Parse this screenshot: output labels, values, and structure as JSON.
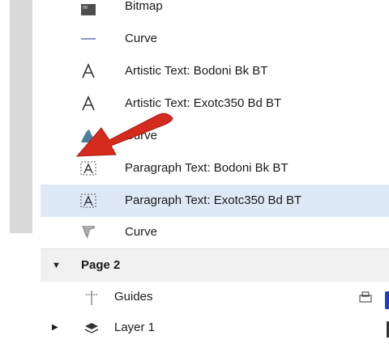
{
  "objects": [
    {
      "label": "Bitmap",
      "icon": "bitmap-icon"
    },
    {
      "label": "Curve",
      "icon": "curve-line-icon"
    },
    {
      "label": "Artistic Text: Bodoni Bk BT",
      "icon": "artistic-text-icon"
    },
    {
      "label": "Artistic Text: Exotc350 Bd BT",
      "icon": "artistic-text-icon"
    },
    {
      "label": "Curve",
      "icon": "curve-shape-icon"
    },
    {
      "label": "Paragraph Text: Bodoni Bk BT",
      "icon": "paragraph-text-icon"
    },
    {
      "label": "Paragraph Text: Exotc350 Bd BT",
      "icon": "paragraph-text-icon",
      "selected": true
    },
    {
      "label": "Curve",
      "icon": "curve-texture-icon"
    }
  ],
  "page": {
    "label": "Page 2",
    "expanded": true
  },
  "guides": {
    "label": "Guides",
    "icon": "guides-icon"
  },
  "layer": {
    "label": "Layer 1",
    "icon": "layers-icon"
  },
  "colors": {
    "selected_row": "#dde9f6",
    "arrow": "#d42b1e",
    "accent": "#1f3fbf"
  }
}
